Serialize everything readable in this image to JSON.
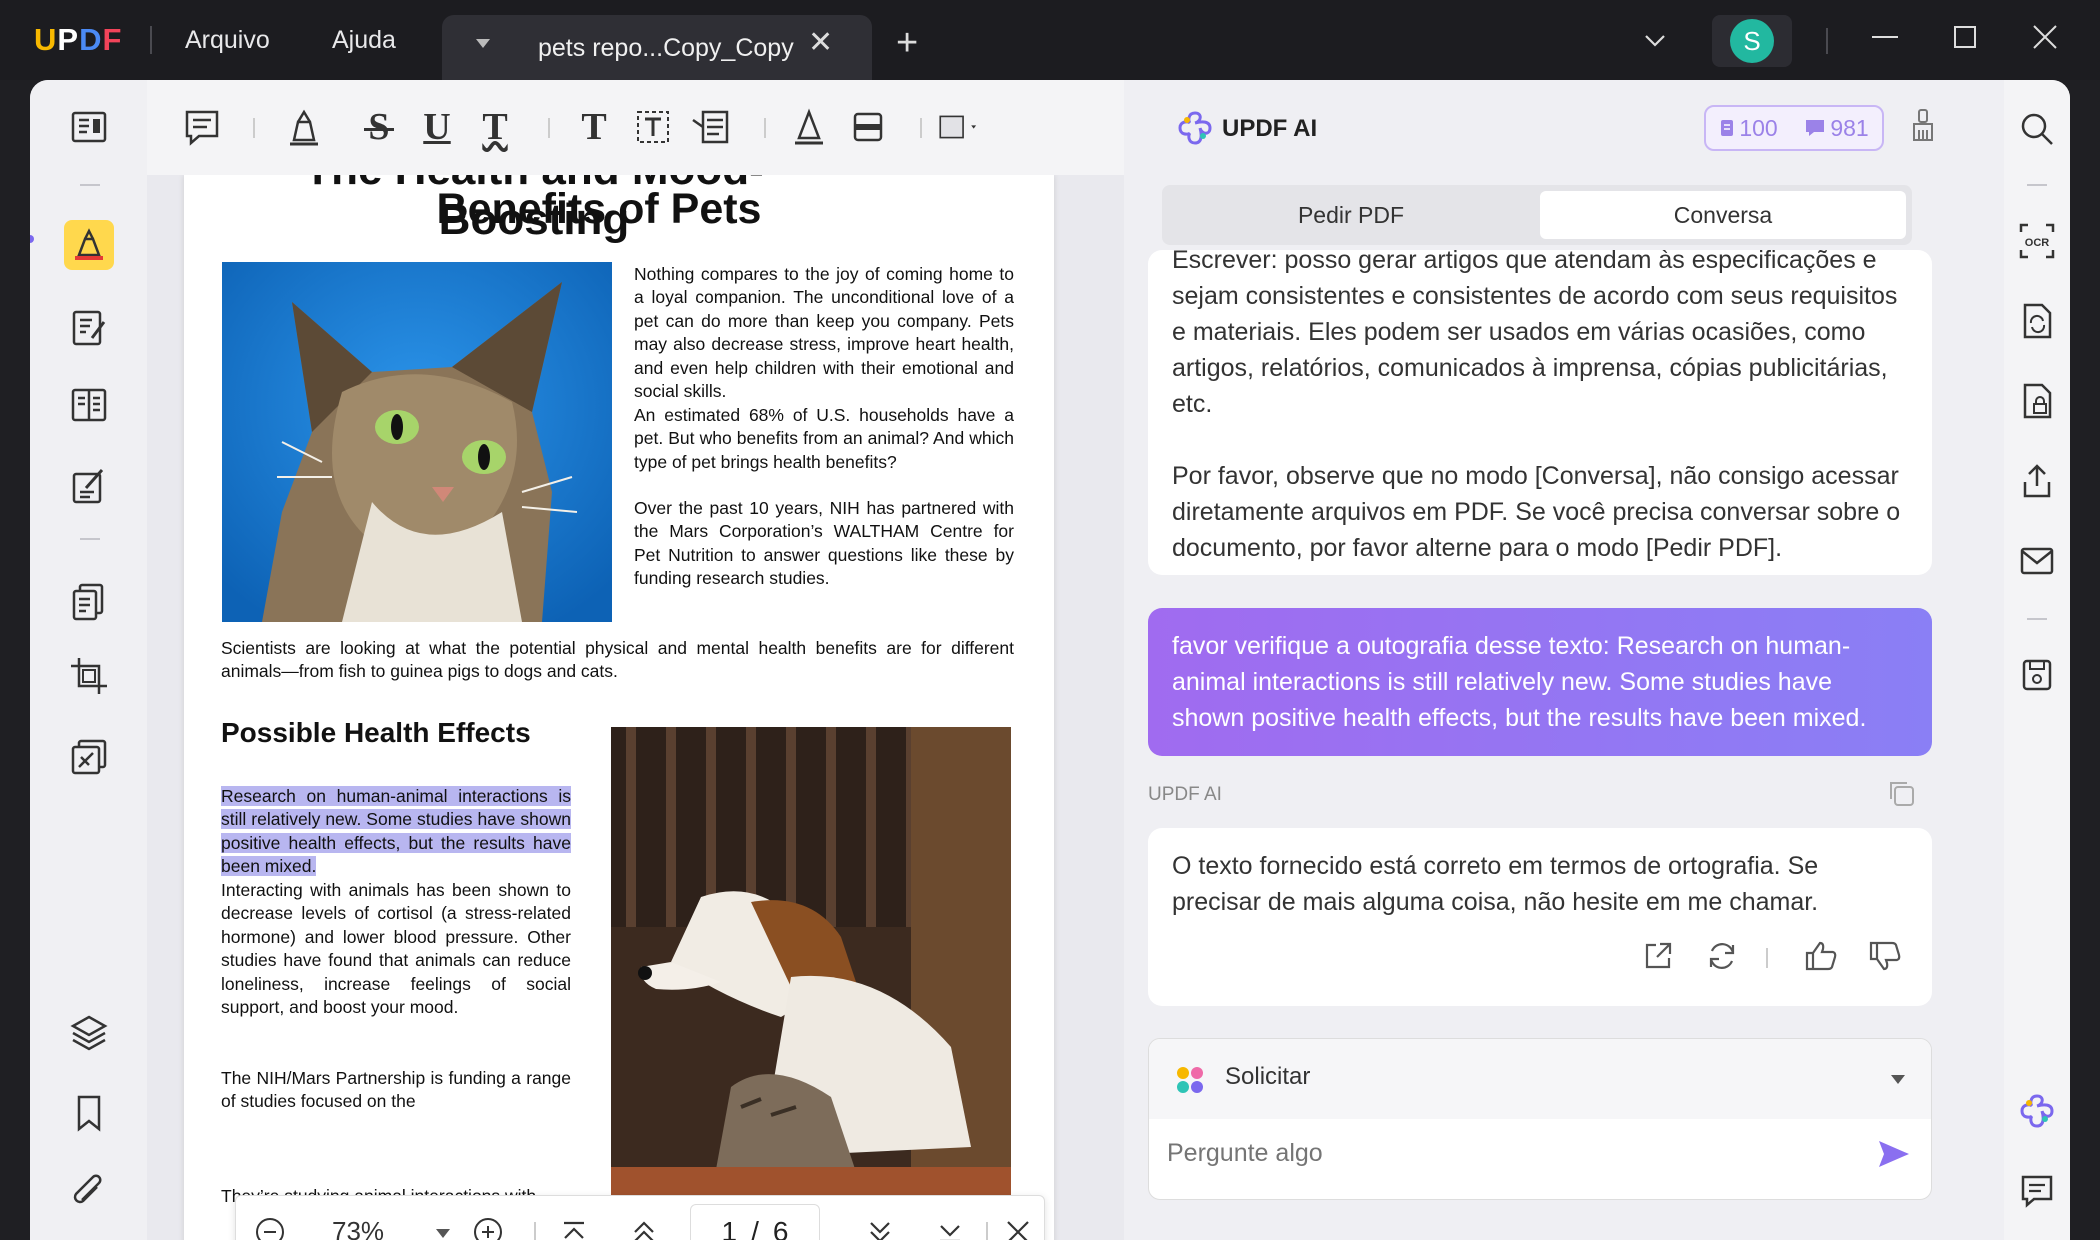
{
  "app": {
    "logo": "UPDF",
    "menu": [
      "Arquivo",
      "Ajuda"
    ],
    "tab_title": "pets repo...Copy_Copy",
    "avatar_initial": "S"
  },
  "document": {
    "title_cut": "The Health and Mood-Boosting",
    "title": "Benefits of Pets",
    "p1": "Nothing compares to the joy of coming home to a loyal companion. The unconditional love of a pet can do more than keep you company. Pets may also decrease stress, improve heart health, and even help children with their emotional and social skills.",
    "p2": "An estimated 68% of U.S. households have a pet. But who benefits from an animal? And which type of pet brings health benefits?",
    "p3": "Over the past 10 years, NIH has partnered with the Mars Corporation’s WALTHAM Centre for Pet Nutrition to answer questions like these by funding research studies.",
    "p4": "Scientists are looking at what the potential physical and mental health benefits are for different animals—from fish to guinea pigs to dogs and cats.",
    "h2": "Possible Health Effects",
    "p5_highlight": "Research on human-animal interactions is still relatively new. Some studies have shown positive health effects, but the results have been mixed.",
    "p6": "Interacting with animals has been shown to decrease levels of cortisol (a stress-related hormone) and lower blood pressure. Other studies have found that animals can reduce loneliness, increase feelings of social support, and boost your mood.",
    "p7": "The NIH/Mars Partnership is funding a range of studies focused on the",
    "p8": "They’re studying animal interactions with"
  },
  "nav": {
    "zoom": "73%",
    "current_page": "1",
    "separator": "/",
    "total_pages": "6"
  },
  "ai": {
    "title": "UPDF AI",
    "quota_pdf": "100",
    "quota_chat": "981",
    "tabs": [
      "Pedir PDF",
      "Conversa"
    ],
    "active_tab": 1,
    "msg1": "Escrever: posso gerar artigos que atendam às especificações e sejam consistentes e consistentes de acordo com seus requisitos e materiais. Eles podem ser usados em várias ocasiões, como artigos, relatórios, comunicados à imprensa, cópias publicitárias, etc.",
    "msg1b": "Por favor, observe que no modo [Conversa], não consigo acessar diretamente arquivos em PDF. Se você precisa conversar sobre o documento, por favor alterne para o modo [Pedir PDF].",
    "user_msg": "favor verifique a outografia desse texto: Research on human-animal interactions is still relatively new. Some studies have shown positive health effects, but the results have been mixed.",
    "sender": "UPDF AI",
    "reply": "O texto fornecido está correto em termos de ortografia. Se precisar de mais alguma coisa, não hesite em me chamar.",
    "prompt_label": "Solicitar",
    "input_placeholder": "Pergunte algo"
  },
  "colors": {
    "accent": "#8a7ff5",
    "highlight": "#b8b6f0",
    "active_tool": "#ffd84d"
  }
}
